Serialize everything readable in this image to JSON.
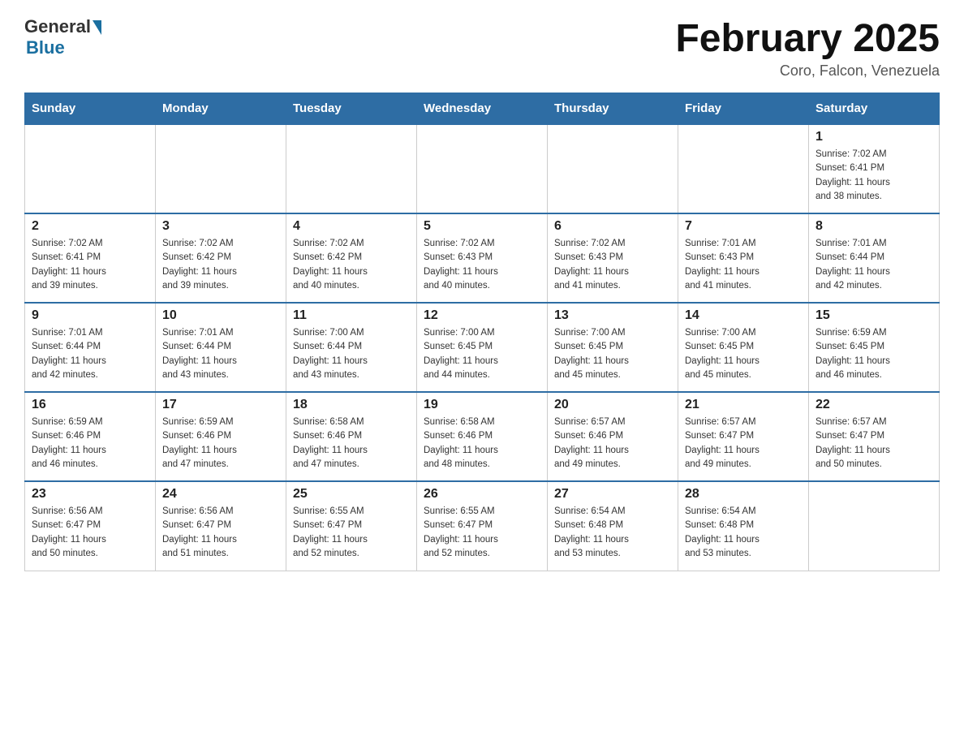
{
  "header": {
    "title": "February 2025",
    "subtitle": "Coro, Falcon, Venezuela"
  },
  "days_of_week": [
    "Sunday",
    "Monday",
    "Tuesday",
    "Wednesday",
    "Thursday",
    "Friday",
    "Saturday"
  ],
  "weeks": [
    [
      {
        "day": "",
        "info": ""
      },
      {
        "day": "",
        "info": ""
      },
      {
        "day": "",
        "info": ""
      },
      {
        "day": "",
        "info": ""
      },
      {
        "day": "",
        "info": ""
      },
      {
        "day": "",
        "info": ""
      },
      {
        "day": "1",
        "info": "Sunrise: 7:02 AM\nSunset: 6:41 PM\nDaylight: 11 hours\nand 38 minutes."
      }
    ],
    [
      {
        "day": "2",
        "info": "Sunrise: 7:02 AM\nSunset: 6:41 PM\nDaylight: 11 hours\nand 39 minutes."
      },
      {
        "day": "3",
        "info": "Sunrise: 7:02 AM\nSunset: 6:42 PM\nDaylight: 11 hours\nand 39 minutes."
      },
      {
        "day": "4",
        "info": "Sunrise: 7:02 AM\nSunset: 6:42 PM\nDaylight: 11 hours\nand 40 minutes."
      },
      {
        "day": "5",
        "info": "Sunrise: 7:02 AM\nSunset: 6:43 PM\nDaylight: 11 hours\nand 40 minutes."
      },
      {
        "day": "6",
        "info": "Sunrise: 7:02 AM\nSunset: 6:43 PM\nDaylight: 11 hours\nand 41 minutes."
      },
      {
        "day": "7",
        "info": "Sunrise: 7:01 AM\nSunset: 6:43 PM\nDaylight: 11 hours\nand 41 minutes."
      },
      {
        "day": "8",
        "info": "Sunrise: 7:01 AM\nSunset: 6:44 PM\nDaylight: 11 hours\nand 42 minutes."
      }
    ],
    [
      {
        "day": "9",
        "info": "Sunrise: 7:01 AM\nSunset: 6:44 PM\nDaylight: 11 hours\nand 42 minutes."
      },
      {
        "day": "10",
        "info": "Sunrise: 7:01 AM\nSunset: 6:44 PM\nDaylight: 11 hours\nand 43 minutes."
      },
      {
        "day": "11",
        "info": "Sunrise: 7:00 AM\nSunset: 6:44 PM\nDaylight: 11 hours\nand 43 minutes."
      },
      {
        "day": "12",
        "info": "Sunrise: 7:00 AM\nSunset: 6:45 PM\nDaylight: 11 hours\nand 44 minutes."
      },
      {
        "day": "13",
        "info": "Sunrise: 7:00 AM\nSunset: 6:45 PM\nDaylight: 11 hours\nand 45 minutes."
      },
      {
        "day": "14",
        "info": "Sunrise: 7:00 AM\nSunset: 6:45 PM\nDaylight: 11 hours\nand 45 minutes."
      },
      {
        "day": "15",
        "info": "Sunrise: 6:59 AM\nSunset: 6:45 PM\nDaylight: 11 hours\nand 46 minutes."
      }
    ],
    [
      {
        "day": "16",
        "info": "Sunrise: 6:59 AM\nSunset: 6:46 PM\nDaylight: 11 hours\nand 46 minutes."
      },
      {
        "day": "17",
        "info": "Sunrise: 6:59 AM\nSunset: 6:46 PM\nDaylight: 11 hours\nand 47 minutes."
      },
      {
        "day": "18",
        "info": "Sunrise: 6:58 AM\nSunset: 6:46 PM\nDaylight: 11 hours\nand 47 minutes."
      },
      {
        "day": "19",
        "info": "Sunrise: 6:58 AM\nSunset: 6:46 PM\nDaylight: 11 hours\nand 48 minutes."
      },
      {
        "day": "20",
        "info": "Sunrise: 6:57 AM\nSunset: 6:46 PM\nDaylight: 11 hours\nand 49 minutes."
      },
      {
        "day": "21",
        "info": "Sunrise: 6:57 AM\nSunset: 6:47 PM\nDaylight: 11 hours\nand 49 minutes."
      },
      {
        "day": "22",
        "info": "Sunrise: 6:57 AM\nSunset: 6:47 PM\nDaylight: 11 hours\nand 50 minutes."
      }
    ],
    [
      {
        "day": "23",
        "info": "Sunrise: 6:56 AM\nSunset: 6:47 PM\nDaylight: 11 hours\nand 50 minutes."
      },
      {
        "day": "24",
        "info": "Sunrise: 6:56 AM\nSunset: 6:47 PM\nDaylight: 11 hours\nand 51 minutes."
      },
      {
        "day": "25",
        "info": "Sunrise: 6:55 AM\nSunset: 6:47 PM\nDaylight: 11 hours\nand 52 minutes."
      },
      {
        "day": "26",
        "info": "Sunrise: 6:55 AM\nSunset: 6:47 PM\nDaylight: 11 hours\nand 52 minutes."
      },
      {
        "day": "27",
        "info": "Sunrise: 6:54 AM\nSunset: 6:48 PM\nDaylight: 11 hours\nand 53 minutes."
      },
      {
        "day": "28",
        "info": "Sunrise: 6:54 AM\nSunset: 6:48 PM\nDaylight: 11 hours\nand 53 minutes."
      },
      {
        "day": "",
        "info": ""
      }
    ]
  ]
}
